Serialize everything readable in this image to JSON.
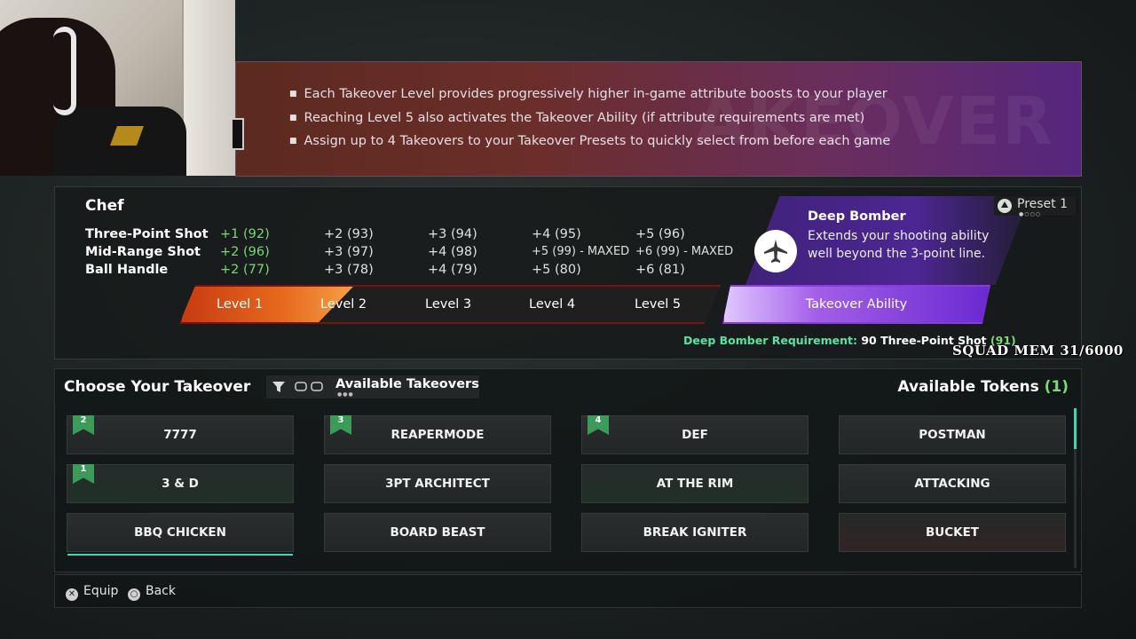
{
  "banner": {
    "watermark": "AKEOVER",
    "bullets": [
      "Each Takeover Level provides progressively higher in-game attribute boosts to your player",
      "Reaching Level 5 also activates the Takeover Ability (if attribute requirements are met)",
      "Assign up to 4 Takeovers to your Takeover Presets to quickly select from before each game"
    ]
  },
  "detail": {
    "name": "Chef",
    "attributes": [
      {
        "label": "Three-Point Shot",
        "values": [
          "+1 (92)",
          "+2 (93)",
          "+3 (94)",
          "+4 (95)",
          "+5 (96)"
        ]
      },
      {
        "label": "Mid-Range Shot",
        "values": [
          "+2 (96)",
          "+3 (97)",
          "+4 (98)",
          "+5 (99) - MAXED",
          "+6 (99) - MAXED"
        ]
      },
      {
        "label": "Ball Handle",
        "values": [
          "+2 (77)",
          "+3 (78)",
          "+4 (79)",
          "+5 (80)",
          "+6 (81)"
        ]
      }
    ],
    "active_level_fraction": 0.2,
    "levels": [
      "Level 1",
      "Level 2",
      "Level 3",
      "Level 4",
      "Level 5"
    ],
    "ability_label": "Takeover Ability",
    "ability": {
      "title": "Deep Bomber",
      "description": "Extends your shooting ability well beyond the 3-point line.",
      "icon": "airplane-icon"
    },
    "preset": {
      "label": "Preset 1",
      "dots": "●○○○"
    },
    "requirement": {
      "label": "Deep Bomber Requirement:",
      "text": "90 Three-Point Shot",
      "value": "(91)"
    }
  },
  "overlay": {
    "squad_text": "SQUAD MEM 31/6000"
  },
  "choose": {
    "title": "Choose Your Takeover",
    "filter_label": "Available Takeovers",
    "filter_dots": "●●●",
    "tokens_label": "Available Tokens",
    "tokens_count": "(1)",
    "tiles": [
      {
        "label": "7777",
        "badge": "2",
        "glow": ""
      },
      {
        "label": "REAPERMODE",
        "badge": "3",
        "glow": ""
      },
      {
        "label": "DEF",
        "badge": "4",
        "glow": ""
      },
      {
        "label": "POSTMAN",
        "badge": "",
        "glow": ""
      },
      {
        "label": "3 & D",
        "badge": "1",
        "glow": "green"
      },
      {
        "label": "3PT ARCHITECT",
        "badge": "",
        "glow": ""
      },
      {
        "label": "AT THE RIM",
        "badge": "",
        "glow": "green"
      },
      {
        "label": "ATTACKING",
        "badge": "",
        "glow": ""
      },
      {
        "label": "BBQ CHICKEN",
        "badge": "",
        "glow": "",
        "selected": true
      },
      {
        "label": "BOARD BEAST",
        "badge": "",
        "glow": ""
      },
      {
        "label": "BREAK IGNITER",
        "badge": "",
        "glow": ""
      },
      {
        "label": "BUCKET",
        "badge": "",
        "glow": "red"
      }
    ]
  },
  "footer": {
    "equip": "Equip",
    "back": "Back"
  }
}
